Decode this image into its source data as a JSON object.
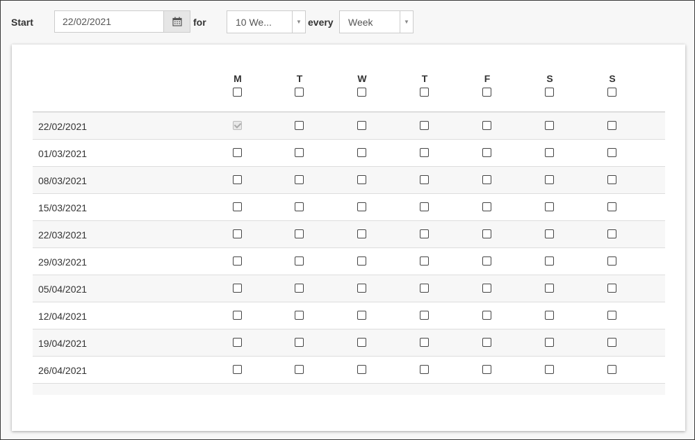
{
  "toolbar": {
    "start_label": "Start",
    "start_date": "22/02/2021",
    "for_label": "for",
    "duration_value": "10 We...",
    "every_label": "every",
    "interval_value": "Week"
  },
  "grid": {
    "days": [
      "M",
      "T",
      "W",
      "T",
      "F",
      "S",
      "S"
    ],
    "rows": [
      {
        "date": "22/02/2021",
        "checked": [
          true,
          false,
          false,
          false,
          false,
          false,
          false
        ],
        "disabled": [
          true,
          false,
          false,
          false,
          false,
          false,
          false
        ]
      },
      {
        "date": "01/03/2021",
        "checked": [
          false,
          false,
          false,
          false,
          false,
          false,
          false
        ]
      },
      {
        "date": "08/03/2021",
        "checked": [
          false,
          false,
          false,
          false,
          false,
          false,
          false
        ]
      },
      {
        "date": "15/03/2021",
        "checked": [
          false,
          false,
          false,
          false,
          false,
          false,
          false
        ]
      },
      {
        "date": "22/03/2021",
        "checked": [
          false,
          false,
          false,
          false,
          false,
          false,
          false
        ]
      },
      {
        "date": "29/03/2021",
        "checked": [
          false,
          false,
          false,
          false,
          false,
          false,
          false
        ]
      },
      {
        "date": "05/04/2021",
        "checked": [
          false,
          false,
          false,
          false,
          false,
          false,
          false
        ]
      },
      {
        "date": "12/04/2021",
        "checked": [
          false,
          false,
          false,
          false,
          false,
          false,
          false
        ]
      },
      {
        "date": "19/04/2021",
        "checked": [
          false,
          false,
          false,
          false,
          false,
          false,
          false
        ]
      },
      {
        "date": "26/04/2021",
        "checked": [
          false,
          false,
          false,
          false,
          false,
          false,
          false
        ]
      }
    ]
  }
}
